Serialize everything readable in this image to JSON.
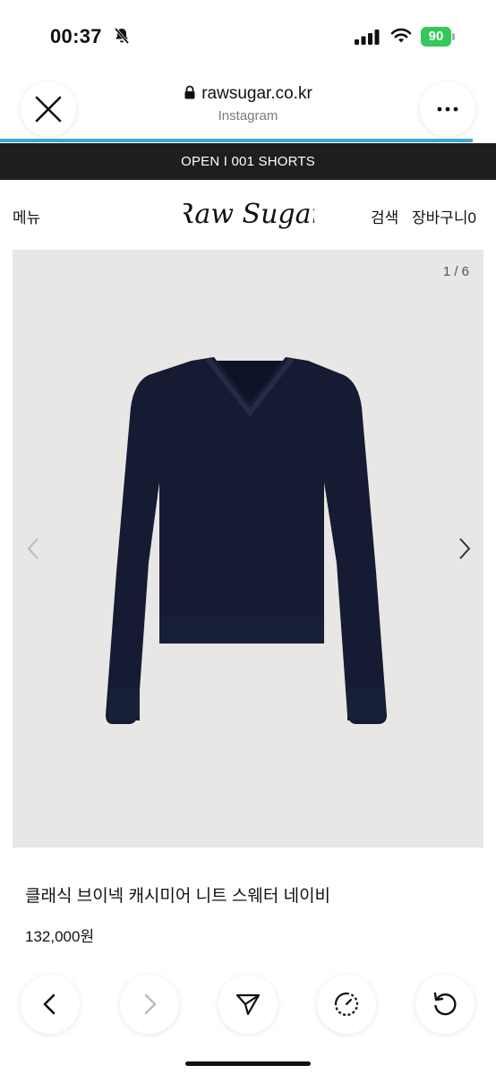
{
  "status_bar": {
    "time": "00:37",
    "battery": "90",
    "icons": [
      "bell-slash-icon",
      "signal-icon",
      "wifi-icon",
      "battery-icon"
    ],
    "battery_color": "#34c759"
  },
  "browser": {
    "url": "rawsugar.co.kr",
    "source": "Instagram",
    "icons": [
      "close-icon",
      "lock-icon",
      "more-icon"
    ],
    "progress_color": "#3aa7d9"
  },
  "site": {
    "announcement": "OPEN I 001 SHORTS",
    "nav": {
      "menu": "메뉴",
      "logo": "Raw Sugar",
      "search": "검색",
      "cart": "장바구니0"
    }
  },
  "product": {
    "image_counter": "1 / 6",
    "image_bg": "#e8e7e5",
    "sweater_color": "#141b33",
    "title": "클래식 브이넥 캐시미어 니트 스웨터 네이비",
    "price": "132,000원"
  },
  "toolbar": {
    "buttons": [
      "back-icon",
      "forward-icon",
      "share-icon",
      "history-icon",
      "reload-icon"
    ]
  }
}
